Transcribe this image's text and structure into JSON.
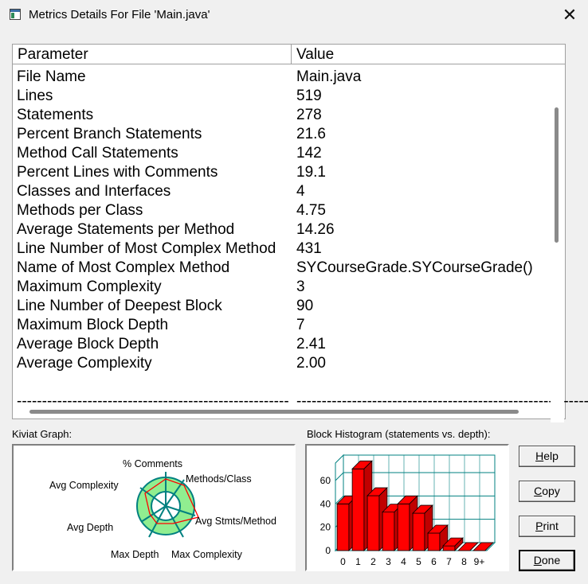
{
  "window": {
    "title": "Metrics Details For File 'Main.java'",
    "close_glyph": "✕"
  },
  "list": {
    "columns": [
      "Parameter",
      "Value"
    ],
    "rows": [
      {
        "param": "File Name",
        "value": "Main.java"
      },
      {
        "param": "Lines",
        "value": "519"
      },
      {
        "param": "Statements",
        "value": "278"
      },
      {
        "param": "Percent Branch Statements",
        "value": "21.6"
      },
      {
        "param": "Method Call Statements",
        "value": "142"
      },
      {
        "param": "Percent Lines with Comments",
        "value": "19.1"
      },
      {
        "param": "Classes and Interfaces",
        "value": "4"
      },
      {
        "param": "Methods per Class",
        "value": "4.75"
      },
      {
        "param": "Average Statements per Method",
        "value": "14.26"
      },
      {
        "param": "Line Number of Most Complex Method",
        "value": "431"
      },
      {
        "param": "Name of Most Complex Method",
        "value": "SYCourseGrade.SYCourseGrade()"
      },
      {
        "param": "Maximum Complexity",
        "value": "3"
      },
      {
        "param": "Line Number of Deepest Block",
        "value": "90"
      },
      {
        "param": "Maximum Block Depth",
        "value": "7"
      },
      {
        "param": "Average Block Depth",
        "value": "2.41"
      },
      {
        "param": "Average Complexity",
        "value": "2.00"
      },
      {
        "param": "",
        "value": ""
      },
      {
        "param": "------------------------------------------------------",
        "value": "--------------------------------------------------------------"
      }
    ]
  },
  "kiviat": {
    "label": "Kiviat Graph:",
    "axes": [
      "% Comments",
      "Methods/Class",
      "Avg Stmts/Method",
      "Max Complexity",
      "Max Depth",
      "Avg Depth",
      "Avg Complexity"
    ]
  },
  "histogram": {
    "label": "Block Histogram (statements vs. depth):"
  },
  "chart_data": {
    "type": "bar",
    "categories": [
      "0",
      "1",
      "2",
      "3",
      "4",
      "5",
      "6",
      "7",
      "8",
      "9+"
    ],
    "values": [
      40,
      70,
      47,
      33,
      40,
      32,
      15,
      4,
      0,
      0
    ],
    "title": "",
    "xlabel": "",
    "ylabel": "",
    "ylim": [
      0,
      75
    ],
    "yticks": [
      "0",
      "20",
      "40",
      "60"
    ],
    "bar_color": "#ff0000",
    "grid": true
  },
  "buttons": {
    "help": {
      "u": "H",
      "rest": "elp"
    },
    "copy": {
      "u": "C",
      "rest": "opy"
    },
    "print": {
      "u": "P",
      "rest": "rint"
    },
    "done": {
      "u": "D",
      "rest": "one"
    }
  },
  "colors": {
    "kiviat_band": "#90ee90",
    "kiviat_line": "#008080",
    "kiviat_plot": "#ff0000",
    "grid_line": "#008080"
  }
}
